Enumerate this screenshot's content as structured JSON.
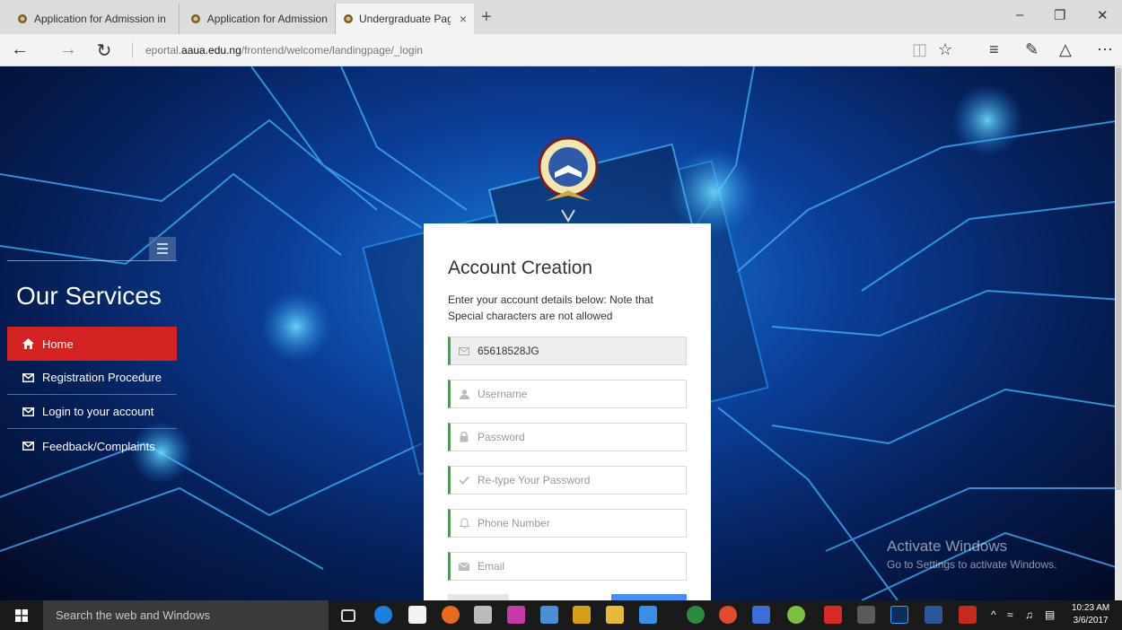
{
  "browser": {
    "tabs": [
      {
        "label": "Application for Admission in",
        "active": false
      },
      {
        "label": "Application for Admission in",
        "active": false
      },
      {
        "label": "Undergraduate Page | A",
        "active": true
      }
    ],
    "new_tab_icon": "plus-icon",
    "address": {
      "prefix": "eportal.",
      "host": "aaua.edu.ng",
      "path": "/frontend/welcome/landingpage/_login"
    }
  },
  "sidebar": {
    "title": "Our Services",
    "items": [
      {
        "label": "Home",
        "icon": "home-icon",
        "active": true
      },
      {
        "label": "Registration Procedure",
        "icon": "envelope-icon",
        "active": false
      },
      {
        "label": "Login to your account",
        "icon": "envelope-icon",
        "active": false
      },
      {
        "label": "Feedback/Complaints",
        "icon": "envelope-icon",
        "active": false
      }
    ]
  },
  "form": {
    "title": "Account Creation",
    "note": "Enter your account details below: Note that Special characters are not allowed",
    "fields": {
      "reg_number": {
        "value": "65618528JG",
        "icon": "envelope-icon"
      },
      "username": {
        "placeholder": "Username",
        "icon": "user-icon"
      },
      "password": {
        "placeholder": "Password",
        "icon": "lock-icon"
      },
      "retype_password": {
        "placeholder": "Re-type Your Password",
        "icon": "check-icon"
      },
      "phone": {
        "placeholder": "Phone Number",
        "icon": "bell-icon"
      },
      "email": {
        "placeholder": "Email",
        "icon": "envelope-icon"
      }
    }
  },
  "watermark": {
    "line1": "Activate Windows",
    "line2": "Go to Settings to activate Windows."
  },
  "taskbar": {
    "search_placeholder": "Search the web and Windows",
    "time": "10:23 AM",
    "date": "3/6/2017"
  },
  "colors": {
    "accent_red": "#d32222",
    "field_bar": "#35aa47",
    "submit_blue": "#4b8df8"
  }
}
